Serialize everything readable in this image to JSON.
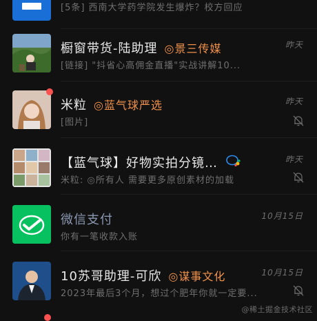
{
  "chats": [
    {
      "name": "",
      "tag": "",
      "preview": "[5条] 西南大学药学院发生爆炸？校方回应",
      "time": "",
      "muted": false
    },
    {
      "name": "橱窗带货-陆助理",
      "tag": "◎景三传媒",
      "preview": "[链接] \"抖省心高佣金直播\"实战讲解10...",
      "time": "昨天",
      "muted": false
    },
    {
      "name": "米粒",
      "tag": "◎蓝气球严选",
      "preview": "[图片]",
      "time": "昨天",
      "muted": true,
      "unread_dot": true
    },
    {
      "name": "【蓝气球】好物实拍分镜…",
      "tag": "",
      "preview": "米粒: ◎所有人  需要更多原创素材的加载",
      "time": "昨天",
      "muted": true
    },
    {
      "name": "微信支付",
      "tag": "",
      "preview": "你有一笔收款入账",
      "time": "10月15日",
      "muted": false
    },
    {
      "name": "10苏哥助理-可欣",
      "tag": "◎谋事文化",
      "preview": "2023年最后3个月，想过个肥年你就一定要...",
      "time": "10月15日",
      "muted": true
    }
  ],
  "watermark": "@稀土掘金技术社区",
  "colors": {
    "background": "#111111",
    "name": "#e8e8e8",
    "tag": "#f0914a",
    "preview": "#6f6f6f",
    "wechat_pay_green": "#07c160",
    "unread_red": "#fa5151"
  }
}
